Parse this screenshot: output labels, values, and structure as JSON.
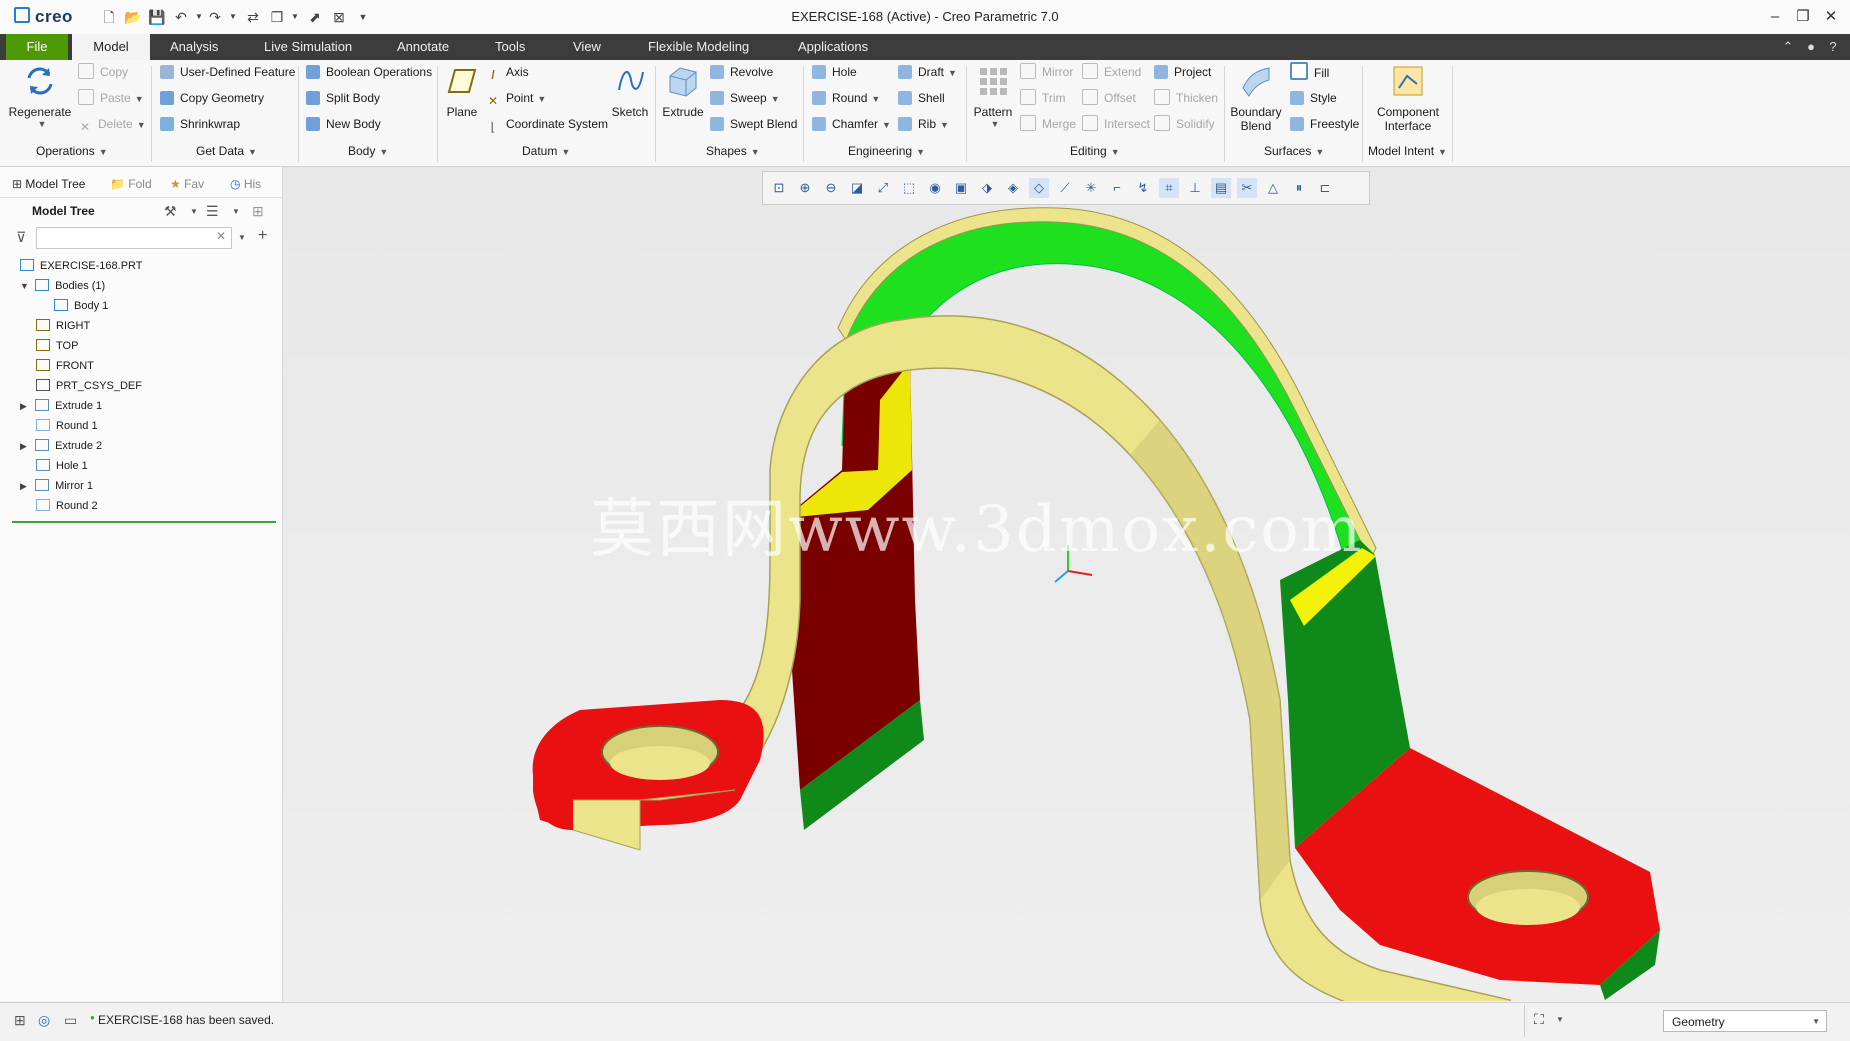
{
  "app": {
    "logo": "creo",
    "window_title": "EXERCISE-168 (Active) - Creo Parametric 7.0"
  },
  "menu": {
    "tabs": [
      "File",
      "Model",
      "Analysis",
      "Live Simulation",
      "Annotate",
      "Tools",
      "View",
      "Flexible Modeling",
      "Applications"
    ],
    "active": "Model"
  },
  "ribbon": {
    "operations": {
      "regenerate": "Regenerate",
      "copy": "Copy",
      "paste": "Paste",
      "delete": "Delete",
      "group": "Operations"
    },
    "get_data": {
      "udf": "User-Defined Feature",
      "copy_geometry": "Copy Geometry",
      "shrinkwrap": "Shrinkwrap",
      "group": "Get Data"
    },
    "body": {
      "boolean": "Boolean Operations",
      "split": "Split Body",
      "new": "New Body",
      "group": "Body"
    },
    "datum": {
      "plane": "Plane",
      "axis": "Axis",
      "point": "Point",
      "csys": "Coordinate System",
      "sketch": "Sketch",
      "group": "Datum"
    },
    "shapes": {
      "extrude": "Extrude",
      "revolve": "Revolve",
      "sweep": "Sweep",
      "swept_blend": "Swept Blend",
      "group": "Shapes"
    },
    "engineering": {
      "hole": "Hole",
      "round": "Round",
      "chamfer": "Chamfer",
      "draft": "Draft",
      "shell": "Shell",
      "rib": "Rib",
      "group": "Engineering"
    },
    "editing": {
      "pattern": "Pattern",
      "mirror": "Mirror",
      "trim": "Trim",
      "merge": "Merge",
      "extend": "Extend",
      "offset": "Offset",
      "intersect": "Intersect",
      "project": "Project",
      "thicken": "Thicken",
      "solidify": "Solidify",
      "group": "Editing"
    },
    "surfaces": {
      "boundary_blend": "Boundary Blend",
      "fill": "Fill",
      "style": "Style",
      "freestyle": "Freestyle",
      "group": "Surfaces"
    },
    "model_intent": {
      "component_interface": "Component Interface",
      "group": "Model Intent"
    }
  },
  "left_panel": {
    "tabs": [
      "Model Tree",
      "Fold",
      "Fav",
      "His"
    ],
    "header": "Model Tree",
    "search_value": "",
    "tree": [
      {
        "label": "EXERCISE-168.PRT",
        "icon": "part-icon",
        "level": 0,
        "expand": ""
      },
      {
        "label": "Bodies (1)",
        "icon": "bodies-icon",
        "level": 1,
        "expand": "▼"
      },
      {
        "label": "Body 1",
        "icon": "body-icon",
        "level": 2,
        "expand": ""
      },
      {
        "label": "RIGHT",
        "icon": "datum-plane-icon",
        "level": 1,
        "expand": ""
      },
      {
        "label": "TOP",
        "icon": "datum-plane-icon",
        "level": 1,
        "expand": ""
      },
      {
        "label": "FRONT",
        "icon": "datum-plane-icon",
        "level": 1,
        "expand": ""
      },
      {
        "label": "PRT_CSYS_DEF",
        "icon": "csys-icon",
        "level": 1,
        "expand": ""
      },
      {
        "label": "Extrude 1",
        "icon": "extrude-icon",
        "level": 1,
        "expand": "▶"
      },
      {
        "label": "Round 1",
        "icon": "round-icon",
        "level": 1,
        "expand": ""
      },
      {
        "label": "Extrude 2",
        "icon": "extrude-icon",
        "level": 1,
        "expand": "▶"
      },
      {
        "label": "Hole 1",
        "icon": "hole-icon",
        "level": 1,
        "expand": ""
      },
      {
        "label": "Mirror 1",
        "icon": "mirror-icon",
        "level": 1,
        "expand": "▶"
      },
      {
        "label": "Round 2",
        "icon": "round-icon",
        "level": 1,
        "expand": ""
      }
    ]
  },
  "viewport": {
    "watermark": "莫西网www.3dmox.com"
  },
  "status": {
    "message": "EXERCISE-168 has been saved.",
    "selection_filter": "Geometry"
  },
  "colors": {
    "menubar": "#3c3c3c",
    "file_tab": "#4e9a06",
    "part_cream": "#ece48a",
    "part_red": "#e81010",
    "part_darkred": "#7a0000",
    "part_green": "#1ee01e",
    "part_darkgreen": "#0f8a1a",
    "part_yellow": "#f2f20a"
  }
}
